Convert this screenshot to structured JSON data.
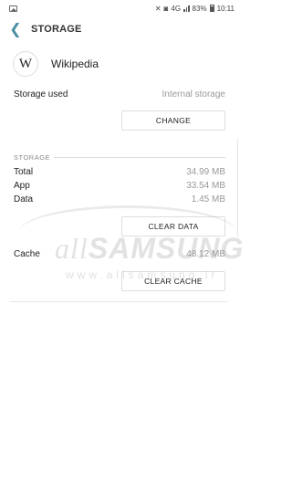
{
  "status_bar": {
    "battery": "83%",
    "time": "10:11",
    "network": "4G"
  },
  "app_bar": {
    "title": "STORAGE"
  },
  "app": {
    "logo_letter": "W",
    "name": "Wikipedia"
  },
  "storage_used": {
    "label": "Storage used",
    "value": "Internal storage",
    "change_button": "CHANGE"
  },
  "storage": {
    "section_title": "STORAGE",
    "rows": [
      {
        "label": "Total",
        "value": "34.99 MB"
      },
      {
        "label": "App",
        "value": "33.54 MB"
      },
      {
        "label": "Data",
        "value": "1.45 MB"
      }
    ],
    "clear_data_button": "CLEAR DATA"
  },
  "cache": {
    "label": "Cache",
    "value": "48.12 MB",
    "clear_cache_button": "CLEAR CACHE"
  },
  "watermark": {
    "prefix": "all",
    "brand": "SAMSUNG",
    "url": "www.allsamsung.ir"
  }
}
